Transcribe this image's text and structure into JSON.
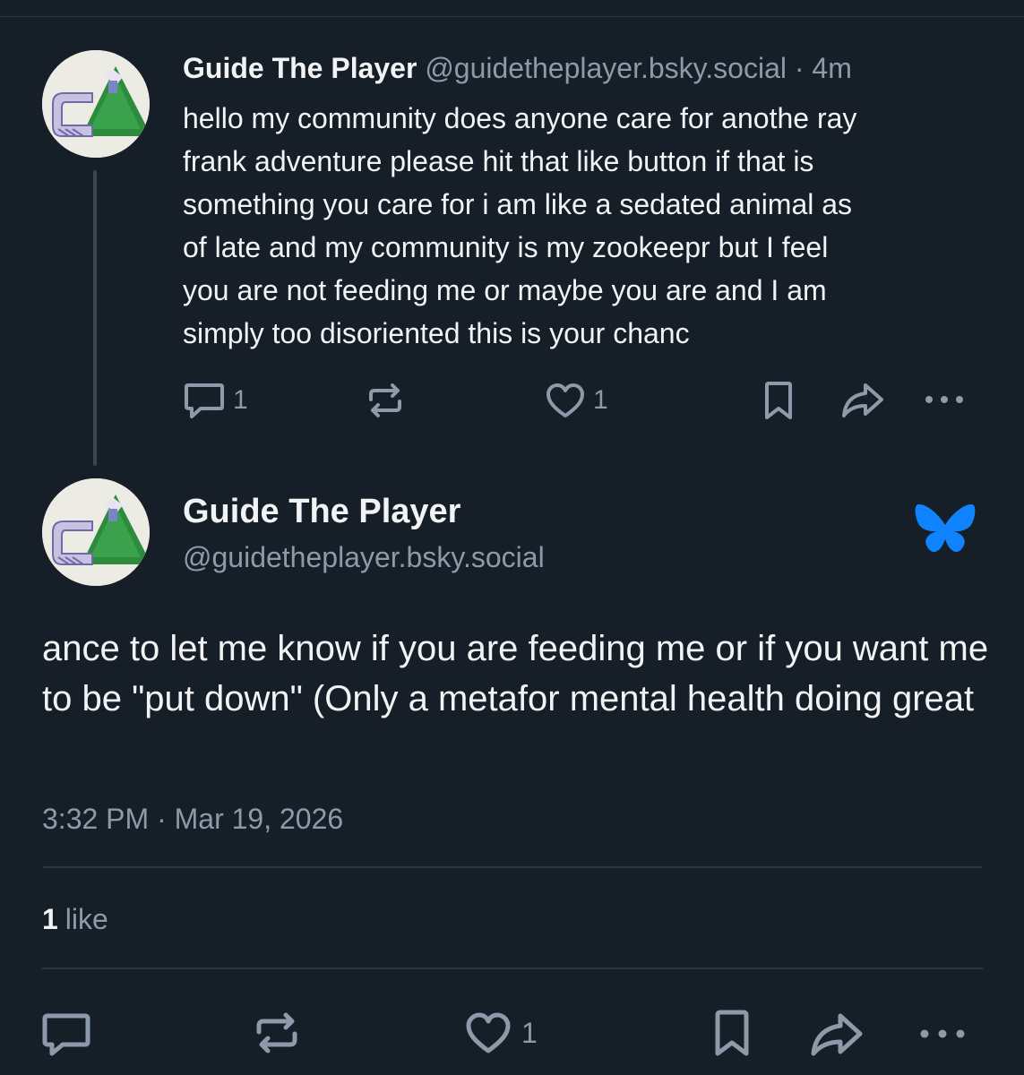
{
  "parent_post": {
    "author_name": "Guide The Player",
    "author_handle": "@guidetheplayer.bsky.social",
    "separator": "·",
    "relative_time": "4m",
    "text": "hello my community does anyone care for anothe ray\nfrank adventure please hit that like button if that is\nsomething you care for i am like a sedated animal as\nof late and my community is my zookeepr but I feel\nyou are not feeding me or maybe you are and I am\nsimply too disoriented this is your chanc",
    "reply_count": "1",
    "like_count": "1",
    "icons": [
      "reply-icon",
      "repost-icon",
      "like-icon",
      "bookmark-icon",
      "share-icon",
      "more-icon"
    ]
  },
  "main_post": {
    "author_name": "Guide The Player",
    "author_handle": "@guidetheplayer.bsky.social",
    "text": "ance to let me know if you are feeding me or if you want me to be \"put down\" (Only a metafor mental health doing great",
    "timestamp": "3:32 PM · Mar 19, 2026",
    "likes_count": "1",
    "likes_label": "like",
    "action_like_count": "1",
    "icons": [
      "reply-icon",
      "repost-icon",
      "like-icon",
      "bookmark-icon",
      "share-icon",
      "more-icon"
    ]
  },
  "colors": {
    "background": "#161e27",
    "text_primary": "#f1f3f5",
    "text_muted": "#8d9aa9",
    "divider": "#2a3542",
    "brand_butterfly": "#1083fe"
  }
}
